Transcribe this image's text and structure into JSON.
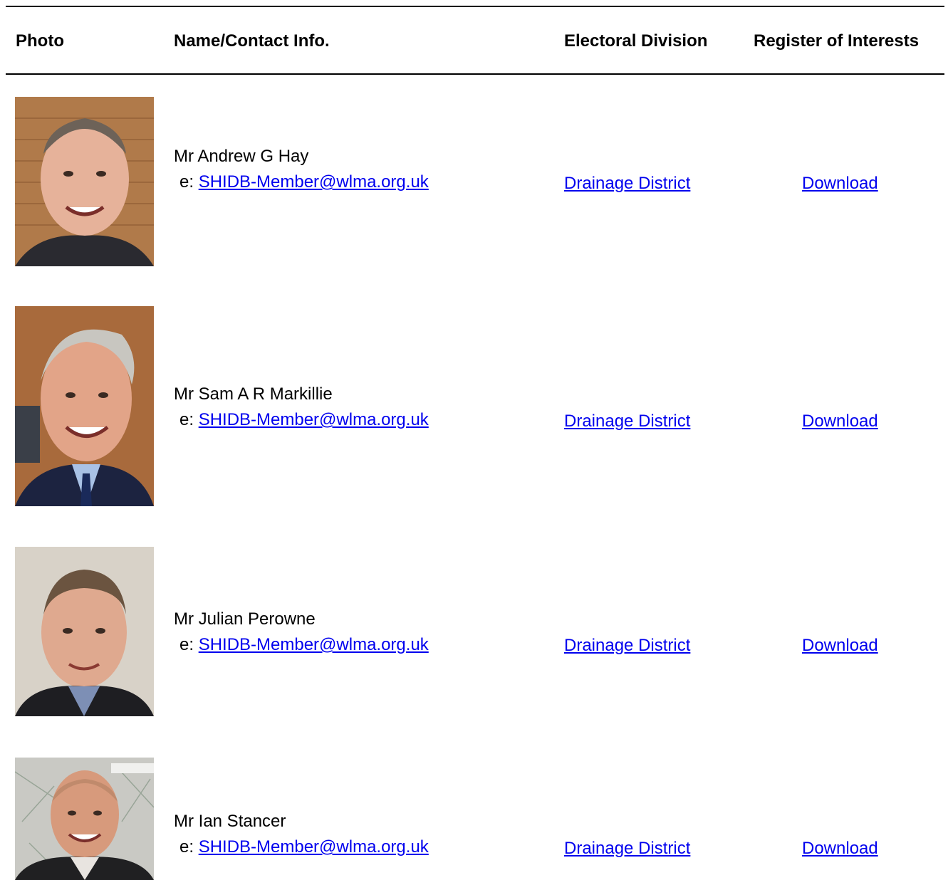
{
  "table": {
    "headers": {
      "photo": "Photo",
      "name": "Name/Contact Info.",
      "division": "Electoral Division",
      "register": "Register of Interests"
    },
    "email_prefix": "e: ",
    "members": [
      {
        "name": "Mr Andrew G Hay",
        "email": "SHIDB-Member@wlma.org.uk",
        "division": "Drainage District",
        "register": "Download",
        "photo_bg": "#b07a4a",
        "photo_clothes": "#2a2a30"
      },
      {
        "name": "Mr Sam A R Markillie",
        "email": "SHIDB-Member@wlma.org.uk",
        "division": "Drainage District",
        "register": "Download",
        "photo_bg": "#a86a3c",
        "photo_clothes": "#1c2340"
      },
      {
        "name": "Mr Julian Perowne",
        "email": "SHIDB-Member@wlma.org.uk",
        "division": "Drainage District",
        "register": "Download",
        "photo_bg": "#d8d2c8",
        "photo_clothes": "#1e1e22"
      },
      {
        "name": "Mr Ian Stancer",
        "email": "SHIDB-Member@wlma.org.uk",
        "division": "Drainage District",
        "register": "Download",
        "photo_bg": "#c9c9c4",
        "photo_clothes": "#202022"
      }
    ]
  },
  "colors": {
    "link": "#0000ee",
    "text": "#000000",
    "rule": "#000000"
  }
}
